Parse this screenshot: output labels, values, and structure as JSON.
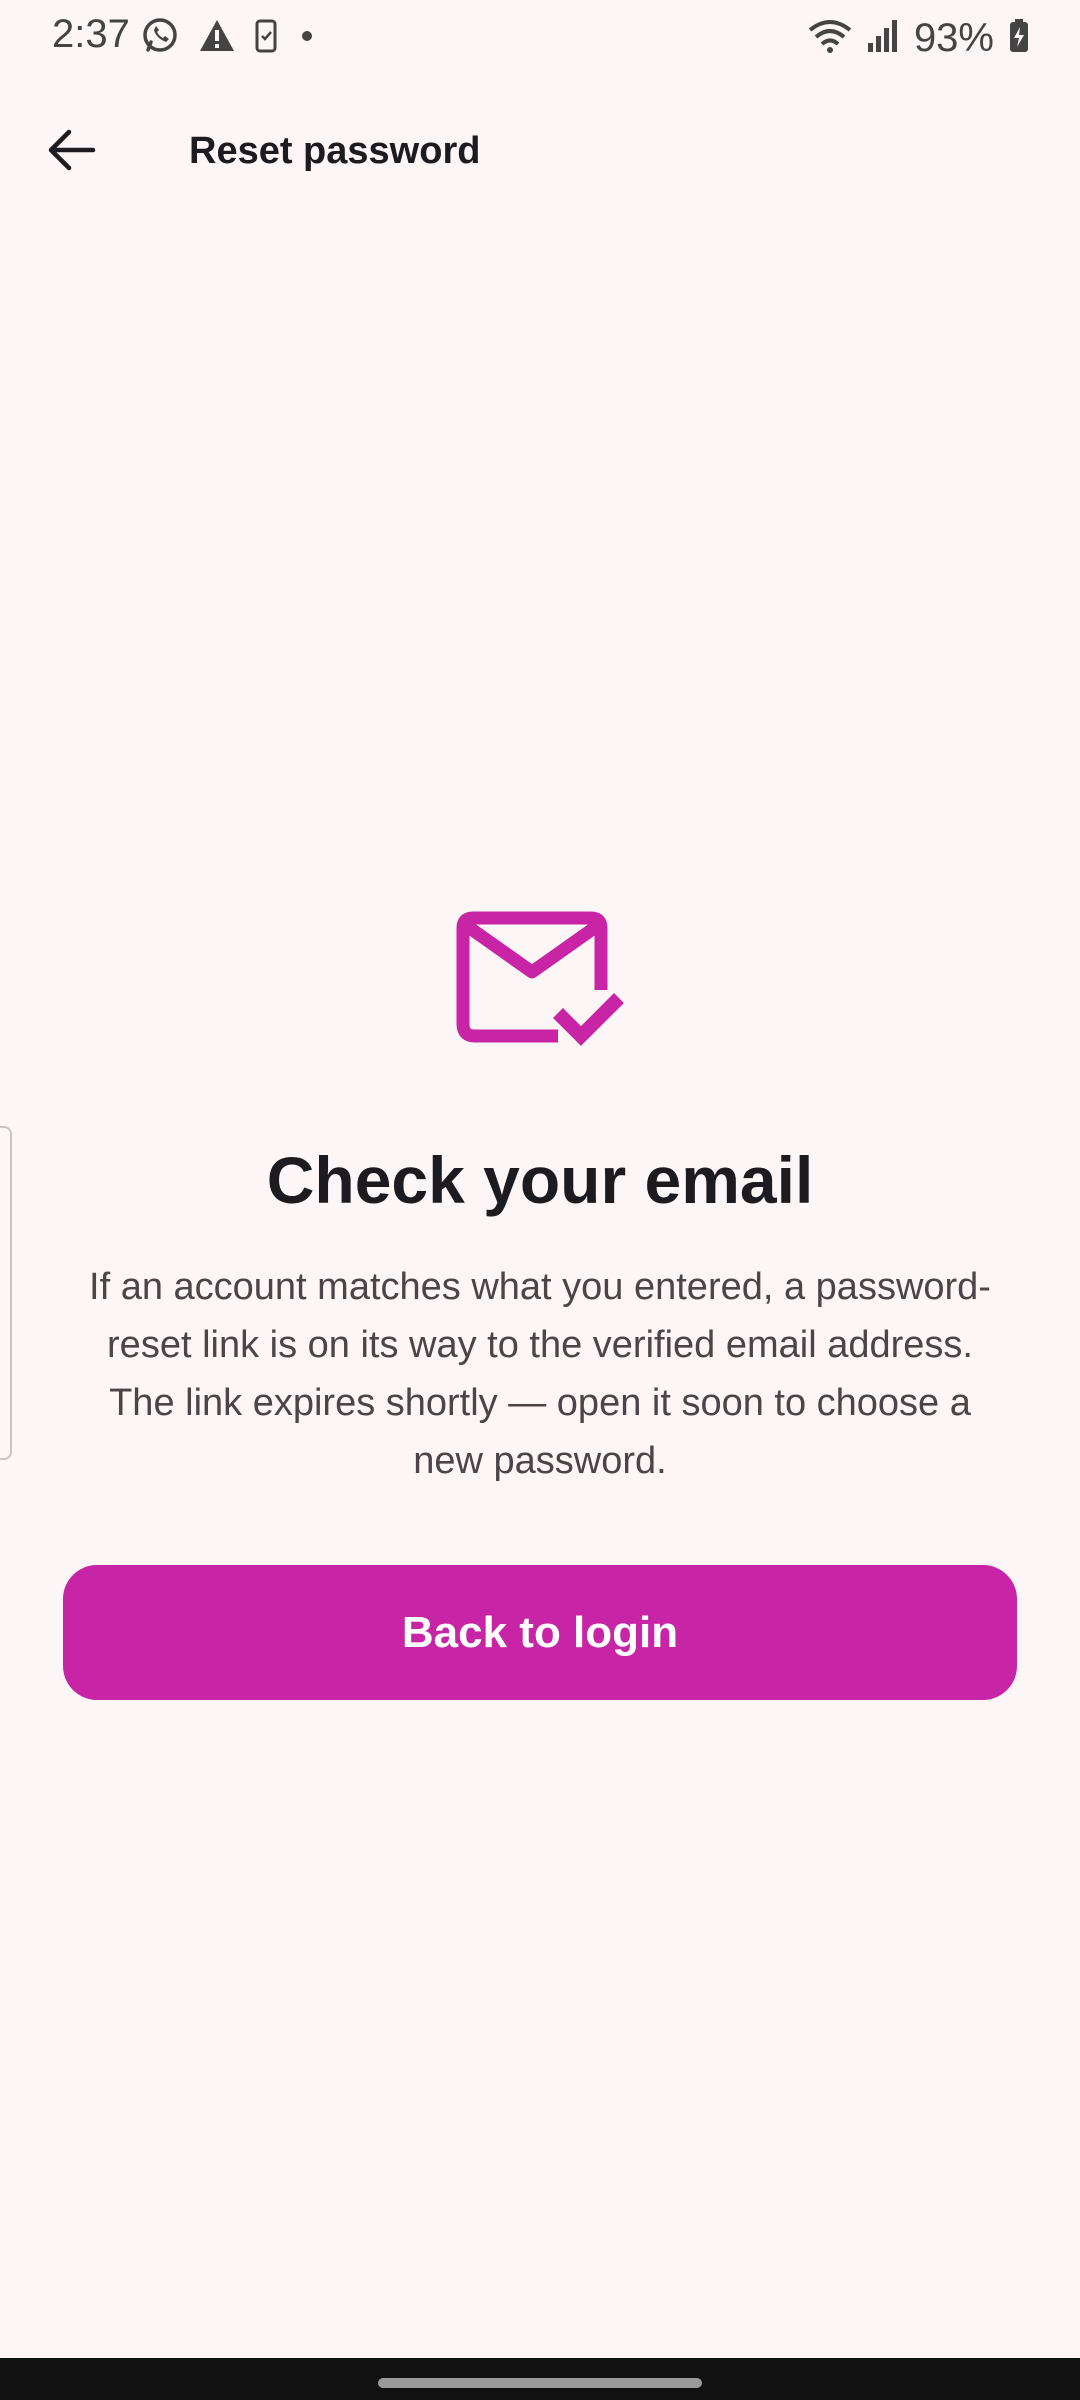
{
  "status_bar": {
    "time": "2:37",
    "battery": "93%",
    "icons": [
      "whatsapp-icon",
      "warning-icon",
      "sim-icon",
      "dot-icon",
      "wifi-icon",
      "signal-icon",
      "battery-charging-icon"
    ]
  },
  "app_bar": {
    "title": "Reset password",
    "back_icon": "arrow-back-icon"
  },
  "content": {
    "icon": "mail-check-icon",
    "headline": "Check your email",
    "body": "If an account matches what you entered, a password-reset link is on its way to the verified email address. The link expires shortly — open it soon to choose a new password.",
    "button_label": "Back to login"
  },
  "colors": {
    "accent": "#c724a6",
    "background": "#fdf6f6",
    "text_primary": "#1c1b1f",
    "text_secondary": "#4a4548"
  }
}
